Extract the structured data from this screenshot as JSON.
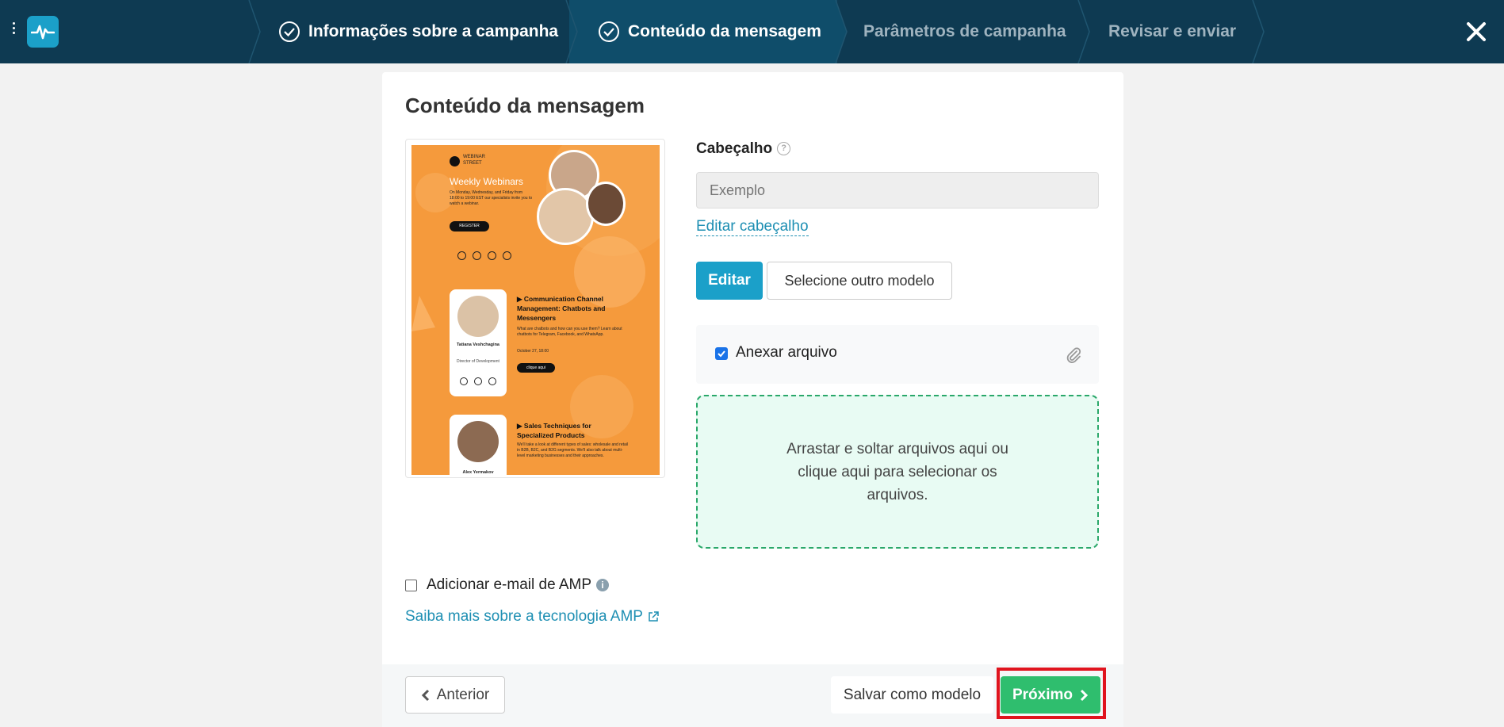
{
  "topbar": {
    "steps": [
      {
        "label": "Informações sobre a campanha",
        "state": "done"
      },
      {
        "label": "Conteúdo da mensagem",
        "state": "active"
      },
      {
        "label": "Parâmetros de campanha",
        "state": "pending"
      },
      {
        "label": "Revisar e enviar",
        "state": "pending"
      }
    ],
    "colors": {
      "bg": "#0e3a52",
      "active_bg": "#0f4d6a",
      "logo": "#1ba0c9"
    }
  },
  "main": {
    "title": "Conteúdo da mensagem",
    "preview": {
      "brand_line1": "WEBINAR",
      "brand_line2": "STREET",
      "heading": "Weekly Webinars",
      "intro": "On Monday, Wednesday, and Friday from 18:00 to 19:00 EST our specialists invite you to watch a webinar.",
      "register_button": "REGISTER",
      "item1": {
        "title": "▶ Communication Channel Management: Chatbots and Messengers",
        "desc": "What are chatbots and how can you use them? Learn about chatbots for Telegram, Facebook, and WhatsApp.",
        "date": "October 27, 18:00",
        "button": "clique aqui",
        "speaker_name": "Tatiana Veshchagina",
        "speaker_role": "Director of Development"
      },
      "item2": {
        "title": "▶ Sales Techniques for Specialized Products",
        "desc": "We'll take a look at different types of sales: wholesale and retail in B2B, B2C, and B2G segments. We'll also talk about multi-level marketing businesses and their approaches.",
        "speaker_name": "Alex Yermakov"
      }
    },
    "header_label": "Cabeçalho",
    "header_placeholder": "Exemplo",
    "edit_header_link": "Editar cabeçalho",
    "edit_button": "Editar",
    "select_template_button": "Selecione outro modelo",
    "attach_label": "Anexar arquivo",
    "attach_checked": true,
    "dropzone_text": "Arrastar e soltar arquivos aqui ou clique aqui para selecionar os arquivos.",
    "amp_label": "Adicionar e-mail de AMP",
    "amp_link": "Saiba mais sobre a tecnologia AMP"
  },
  "footer": {
    "prev_button": "Anterior",
    "save_button": "Salvar como modelo",
    "next_button": "Próximo",
    "next_color": "#2fbe6e",
    "highlight_color": "#e0141e"
  }
}
